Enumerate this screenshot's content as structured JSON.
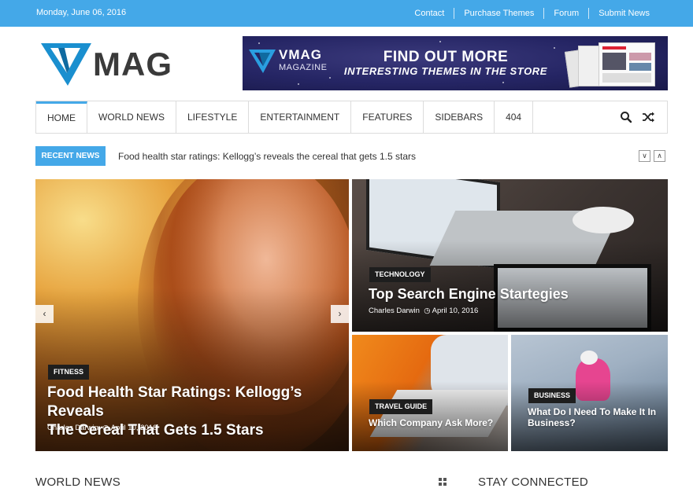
{
  "topbar": {
    "date": "Monday, June 06, 2016",
    "links": [
      "Contact",
      "Purchase Themes",
      "Forum",
      "Submit News"
    ]
  },
  "logo": {
    "text": "MAG"
  },
  "banner": {
    "brand": "VMAG",
    "brand_sub": "MAGAZINE",
    "headline": "FIND OUT MORE",
    "subheadline": "INTERESTING THEMES IN THE STORE"
  },
  "nav": {
    "items": [
      "HOME",
      "WORLD NEWS",
      "LIFESTYLE",
      "ENTERTAINMENT",
      "FEATURES",
      "SIDEBARS",
      "404"
    ],
    "active": "HOME",
    "icons": [
      "search-icon",
      "shuffle-icon"
    ]
  },
  "recent": {
    "label": "RECENT NEWS",
    "headline": "Food health star ratings: Kellogg’s reveals the cereal that gets 1.5 stars"
  },
  "featured": {
    "main": {
      "category": "FITNESS",
      "title_line1": "Food Health Star Ratings: Kellogg’s Reveals",
      "title_line2": "The Cereal That Gets 1.5 Stars",
      "author": "Charles Darwin",
      "date": "April 10, 2016"
    },
    "top_right": {
      "category": "TECHNOLOGY",
      "title": "Top Search Engine Startegies",
      "author": "Charles Darwin",
      "date": "April 10, 2016"
    },
    "bottom_left": {
      "category": "TRAVEL GUIDE",
      "title": "Which Company Ask More?"
    },
    "bottom_right": {
      "category": "BUSINESS",
      "title_line1": "What Do I Need To Make It In",
      "title_line2": "Business?"
    }
  },
  "sections": {
    "left": "WORLD NEWS",
    "right": "STAY CONNECTED"
  },
  "colors": {
    "accent": "#44a8e8",
    "logo": "#1a8fcf"
  }
}
